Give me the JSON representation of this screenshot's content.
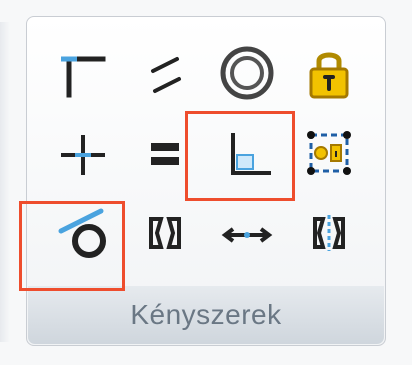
{
  "group": {
    "label": "Kényszerek"
  },
  "tools": [
    {
      "name": "corner-icon"
    },
    {
      "name": "parallel-lines-icon"
    },
    {
      "name": "concentric-circles-icon"
    },
    {
      "name": "lock-icon"
    },
    {
      "name": "crosshair-icon"
    },
    {
      "name": "equal-icon"
    },
    {
      "name": "perpendicular-icon"
    },
    {
      "name": "fix-point-icon"
    },
    {
      "name": "tangent-circle-icon"
    },
    {
      "name": "symmetric-brackets-icon"
    },
    {
      "name": "coincident-arrows-icon"
    },
    {
      "name": "mirror-brackets-icon"
    }
  ],
  "colors": {
    "highlight": "#ee4d2d",
    "icon_dark": "#222222",
    "icon_blue": "#4aa3df",
    "lock_gold": "#f2c200"
  }
}
